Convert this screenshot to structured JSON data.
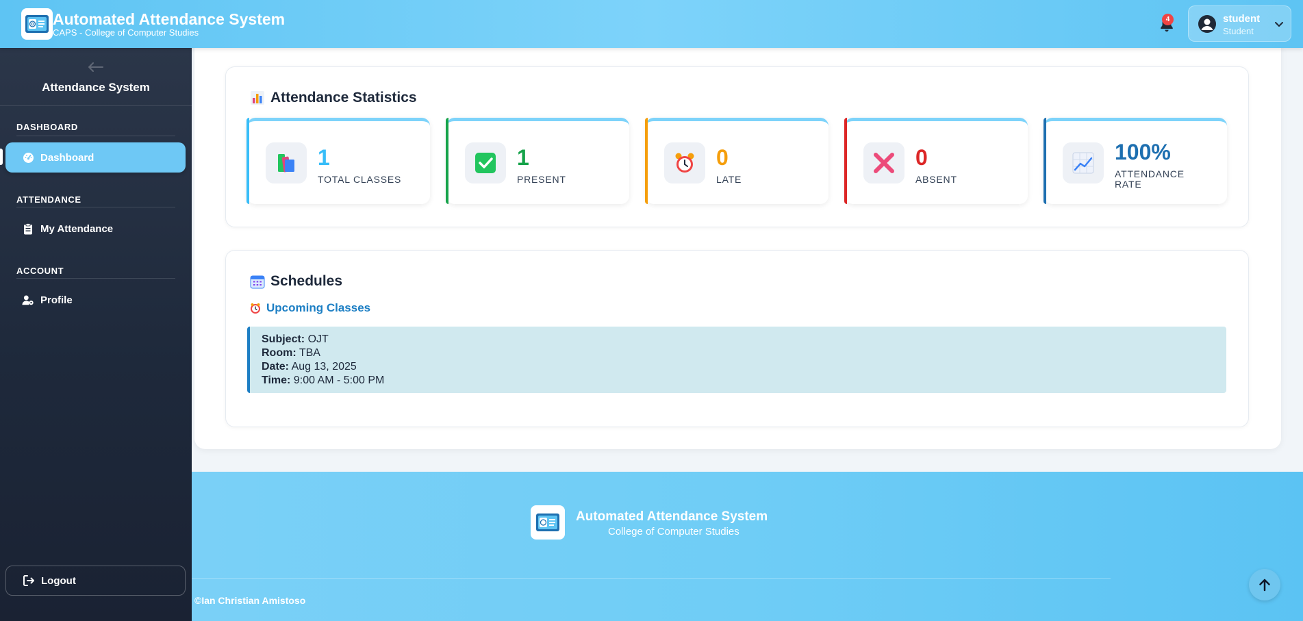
{
  "header": {
    "title": "Automated Attendance System",
    "subtitle": "CAPS - College of Computer Studies",
    "notification_count": "4",
    "user": {
      "name": "student",
      "role": "Student"
    }
  },
  "sidebar": {
    "title": "Attendance System",
    "sections": [
      {
        "label": "DASHBOARD",
        "items": [
          {
            "label": "Dashboard",
            "icon": "gauge-icon",
            "active": true
          }
        ]
      },
      {
        "label": "ATTENDANCE",
        "items": [
          {
            "label": "My Attendance",
            "icon": "clipboard-icon",
            "active": false
          }
        ]
      },
      {
        "label": "ACCOUNT",
        "items": [
          {
            "label": "Profile",
            "icon": "user-gear-icon",
            "active": false
          }
        ]
      }
    ],
    "logout_label": "Logout"
  },
  "statistics": {
    "title": "Attendance Statistics",
    "cards": [
      {
        "value": "1",
        "label": "TOTAL CLASSES",
        "color": "#38bdf8",
        "icon": "books-icon"
      },
      {
        "value": "1",
        "label": "PRESENT",
        "color": "#16a34a",
        "icon": "check-box-icon"
      },
      {
        "value": "0",
        "label": "LATE",
        "color": "#f59e0b",
        "icon": "alarm-clock-icon"
      },
      {
        "value": "0",
        "label": "ABSENT",
        "color": "#dc2626",
        "icon": "cross-icon"
      },
      {
        "value": "100%",
        "label": "ATTENDANCE RATE",
        "color": "#1d6fb0",
        "icon": "trend-chart-icon"
      }
    ]
  },
  "schedules": {
    "title": "Schedules",
    "upcoming_label": "Upcoming Classes",
    "entries": [
      {
        "subject_label": "Subject:",
        "subject": "OJT",
        "room_label": "Room:",
        "room": "TBA",
        "date_label": "Date:",
        "date": "Aug 13, 2025",
        "time_label": "Time:",
        "time": "9:00 AM - 5:00 PM"
      }
    ]
  },
  "footer": {
    "title": "Automated Attendance System",
    "subtitle": "College of Computer Studies",
    "copyright": "©Ian Christian Amistoso"
  },
  "colors": {
    "header_blue": "#5ec4f3",
    "sidebar_dark": "#1e293b",
    "active_nav": "#6ec8f5",
    "link_blue": "#1d7fc4",
    "schedule_bg": "#d0e9ef"
  }
}
